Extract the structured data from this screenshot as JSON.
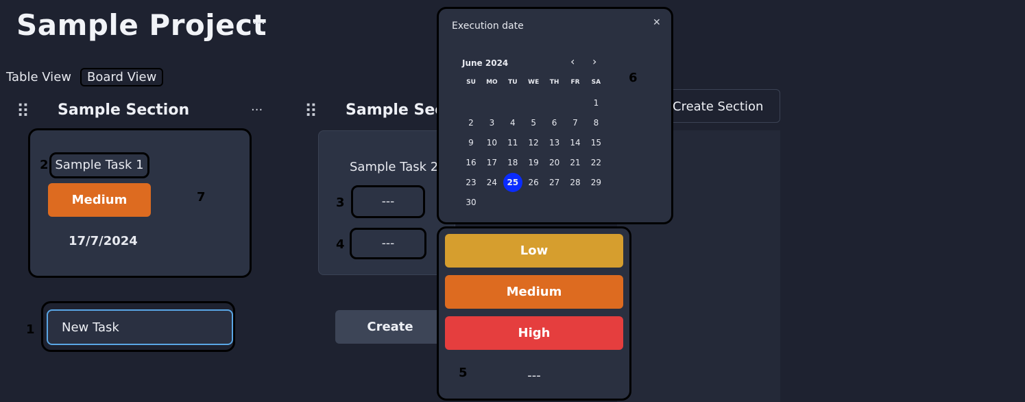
{
  "project": {
    "title": "Sample Project",
    "more_label": "···"
  },
  "views": {
    "table": "Table View",
    "board": "Board View"
  },
  "sections": [
    {
      "drag": "⠿",
      "title": "Sample Section",
      "more": "···",
      "task": {
        "name": "Sample Task 1",
        "priority": "Medium",
        "date": "17/7/2024"
      },
      "new_task_value": "New Task"
    },
    {
      "drag": "⠿",
      "title": "Sample Section",
      "task": {
        "name": "Sample Task 2",
        "priority": "---",
        "date": "---"
      },
      "create_label": "Create"
    }
  ],
  "create_section_label": "Create Section",
  "annotations": [
    "1",
    "2",
    "3",
    "4",
    "5",
    "6",
    "7"
  ],
  "datepicker": {
    "title": "Execution date",
    "close": "✕",
    "month": "June 2024",
    "prev": "‹",
    "next": "›",
    "weekdays": [
      "SU",
      "MO",
      "TU",
      "WE",
      "TH",
      "FR",
      "SA"
    ],
    "selected_day": 25,
    "first_weekday": 6,
    "days_in_month": 30
  },
  "priority_menu": {
    "options": [
      {
        "label": "Low",
        "color": "#d69e2e"
      },
      {
        "label": "Medium",
        "color": "#dd6b20"
      },
      {
        "label": "High",
        "color": "#e53e3e"
      }
    ],
    "none_label": "---"
  },
  "colors": {
    "medium": "#dd6b20",
    "input_border": "#5aa7e6",
    "selected_day": "#0a2bff"
  }
}
